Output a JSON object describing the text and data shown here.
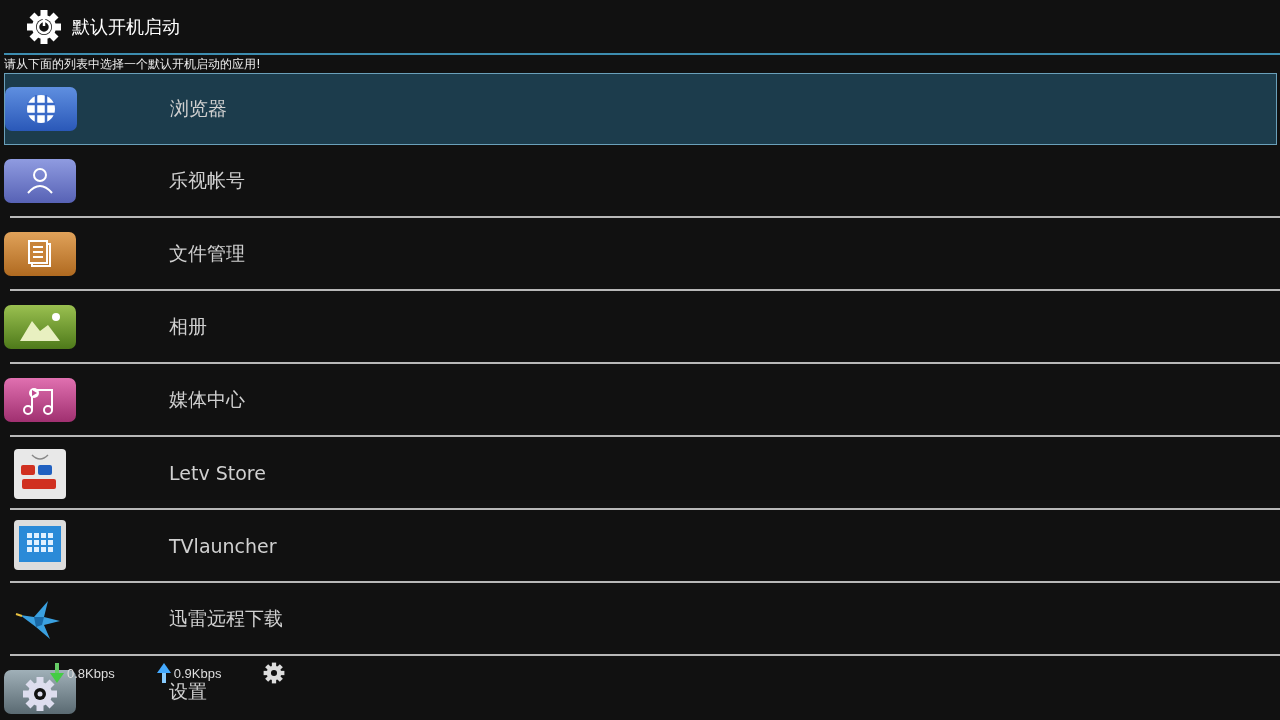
{
  "header": {
    "title": "默认开机启动"
  },
  "prompt": "请从下面的列表中选择一个默认开机启动的应用!",
  "apps": [
    {
      "label": "浏览器",
      "selected": true
    },
    {
      "label": "乐视帐号",
      "selected": false
    },
    {
      "label": "文件管理",
      "selected": false
    },
    {
      "label": "相册",
      "selected": false
    },
    {
      "label": "媒体中心",
      "selected": false
    },
    {
      "label": "Letv Store",
      "selected": false
    },
    {
      "label": "TVlauncher",
      "selected": false
    },
    {
      "label": "迅雷远程下载",
      "selected": false
    },
    {
      "label": "设置",
      "selected": false
    }
  ],
  "speed_overlay": {
    "download": "0.8Kbps",
    "upload": "0.9Kbps"
  }
}
